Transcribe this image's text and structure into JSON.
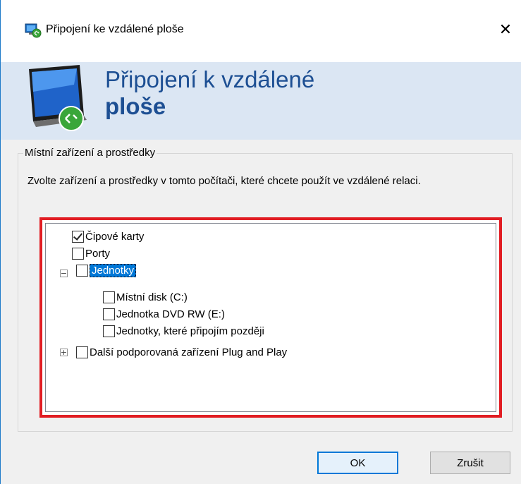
{
  "window": {
    "title": "Připojení ke vzdálené ploše",
    "close_glyph": "✕"
  },
  "banner": {
    "line1": "Připojení k vzdálené",
    "line2": "ploše"
  },
  "group": {
    "legend": "Místní zařízení a prostředky",
    "description": "Zvolte zařízení a prostředky v tomto počítači, které chcete použít ve vzdálené relaci."
  },
  "tree": {
    "items": [
      {
        "label": "Čipové karty",
        "checked": true
      },
      {
        "label": "Porty",
        "checked": false
      },
      {
        "label": "Jednotky",
        "checked": false,
        "expanded": true,
        "selected": true,
        "expander": "−"
      },
      {
        "label": "Místní disk (C:)",
        "checked": false
      },
      {
        "label": "Jednotka DVD RW (E:)",
        "checked": false
      },
      {
        "label": "Jednotky, které připojím později",
        "checked": false
      },
      {
        "label": "Další podporovaná zařízení Plug and Play",
        "checked": false,
        "expanded": false,
        "expander": "+"
      }
    ]
  },
  "buttons": {
    "ok": "OK",
    "cancel": "Zrušit"
  },
  "colors": {
    "highlight_frame": "#e11d23",
    "selection": "#0078d7",
    "banner_bg": "#dbe6f3",
    "banner_text": "#1d4f93"
  }
}
